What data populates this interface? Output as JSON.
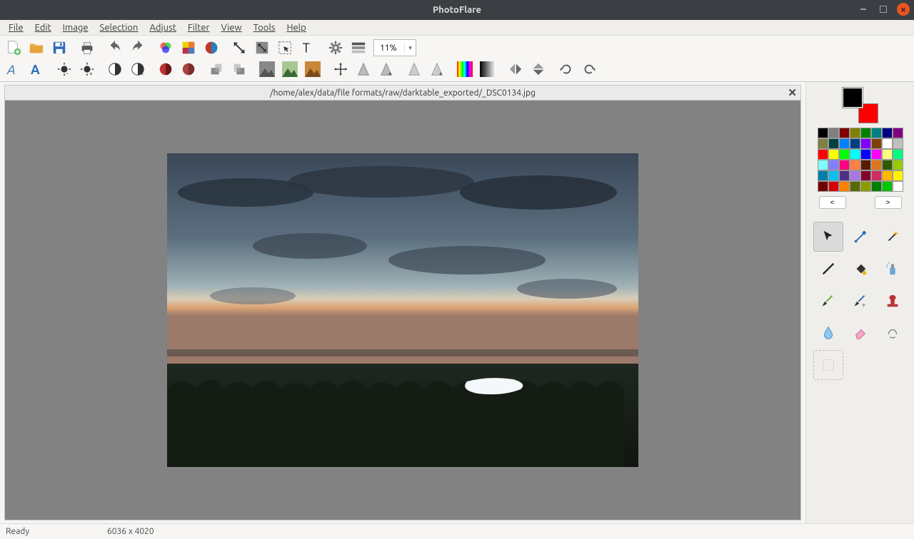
{
  "window": {
    "title": "PhotoFlare"
  },
  "menubar": [
    "File",
    "Edit",
    "Image",
    "Selection",
    "Adjust",
    "Filter",
    "View",
    "Tools",
    "Help"
  ],
  "toolbar": {
    "zoom": "11%"
  },
  "document": {
    "path": "/home/alex/data/file formats/raw/darktable_exported/_DSC0134.jpg"
  },
  "palette_nav": {
    "prev": "<",
    "next": ">"
  },
  "palette_colors": [
    "#000000",
    "#808080",
    "#800000",
    "#808000",
    "#008000",
    "#008080",
    "#000080",
    "#800080",
    "#808040",
    "#004040",
    "#0080ff",
    "#004080",
    "#8000ff",
    "#804000",
    "#ffffff",
    "#c0c0c0",
    "#ff0000",
    "#ffff00",
    "#00ff00",
    "#00ffff",
    "#0000ff",
    "#ff00ff",
    "#ffff80",
    "#00ff80",
    "#80ffff",
    "#8080ff",
    "#ff0080",
    "#ff8040",
    "#5a1b01",
    "#df7419",
    "#305a02",
    "#98cc03",
    "#007fac",
    "#0cbef2",
    "#502f87",
    "#a876e5",
    "#82062a",
    "#cf2d63",
    "#ffb700",
    "#fff300",
    "#6e0000",
    "#d50000",
    "#ff8000",
    "#586800",
    "#8a9d00",
    "#007f00",
    "#00c500",
    "#ffffff"
  ],
  "status": {
    "message": "Ready",
    "dimensions": "6036 x 4020"
  }
}
